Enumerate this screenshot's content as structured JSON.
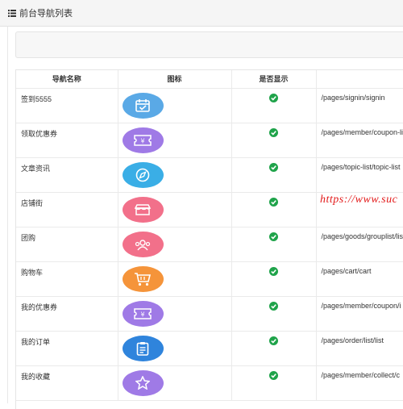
{
  "header": {
    "title": "前台导航列表",
    "icon": "list-icon"
  },
  "table": {
    "columns": [
      "导航名称",
      "图标",
      "是否显示",
      ""
    ],
    "rows": [
      {
        "name": "签到5555",
        "icon": "calendar-icon",
        "icon_color": "#5aa9e6",
        "shown": true,
        "path": "/pages/signin/signin"
      },
      {
        "name": "领取优惠券",
        "icon": "ticket-icon",
        "icon_color": "#9f7ae6",
        "shown": true,
        "path": "/pages/member/coupon-li"
      },
      {
        "name": "文章资讯",
        "icon": "compass-icon",
        "icon_color": "#3aaee6",
        "shown": true,
        "path": "/pages/topic-list/topic-list"
      },
      {
        "name": "店铺街",
        "icon": "store-icon",
        "icon_color": "#f2708a",
        "shown": true,
        "path": ""
      },
      {
        "name": "团购",
        "icon": "group-icon",
        "icon_color": "#f2708a",
        "shown": true,
        "path": "/pages/goods/grouplist/lis"
      },
      {
        "name": "购物车",
        "icon": "cart-icon",
        "icon_color": "#f5943a",
        "shown": true,
        "path": "/pages/cart/cart"
      },
      {
        "name": "我的优惠券",
        "icon": "ticket-icon",
        "icon_color": "#9f7ae6",
        "shown": true,
        "path": "/pages/member/coupon/i"
      },
      {
        "name": "我的订单",
        "icon": "clipboard-icon",
        "icon_color": "#2f84dc",
        "shown": true,
        "path": "/pages/order/list/list"
      },
      {
        "name": "我的收藏",
        "icon": "star-icon",
        "icon_color": "#9f7ae6",
        "shown": true,
        "path": "/pages/member/collect/c"
      }
    ]
  },
  "watermark": "https://www.suc",
  "colors": {
    "check": "#1fa34a",
    "watermark": "#e31b1b"
  }
}
